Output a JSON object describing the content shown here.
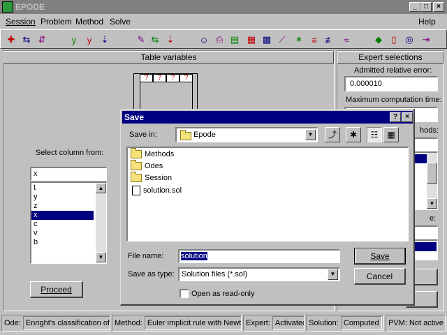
{
  "window": {
    "title": "EPODE",
    "icon": "app-icon"
  },
  "menu": {
    "session": "Session",
    "problem": "Problem",
    "method": "Method",
    "solve": "Solve",
    "help": "Help"
  },
  "toolbar": {
    "icons": [
      "new-problem-icon",
      "save-problem-icon",
      "open-problem-icon",
      "edit-function-icon",
      "edit-jacobian-icon",
      "load-icon",
      "pencil-icon",
      "method-select-icon",
      "method-load-icon",
      "user-icon",
      "printer-icon",
      "table-icon",
      "grid-icon",
      "matrix-icon",
      "chart-icon",
      "phase-plot-icon",
      "range-plot-icon",
      "scale-plot-icon",
      "wave-plot-icon",
      "expert-icon",
      "book-icon",
      "help-circle-icon",
      "exit-icon"
    ]
  },
  "left_panel": {
    "header": "Table variables",
    "table_cells": [
      "?",
      "?",
      "?",
      "?"
    ],
    "select_label": "Select column from:",
    "column_value": "x",
    "columns": [
      "t",
      "y",
      "z",
      "x",
      "c",
      "v",
      "b"
    ],
    "selected_column": "x",
    "proceed": "Proceed"
  },
  "right_panel": {
    "header": "Expert selections",
    "rel_error_label": "Admitted relative error:",
    "rel_error_value": "0.000010",
    "max_time_label": "Maximum computation time:",
    "methods_frag": "hods:",
    "e_frag": "e:"
  },
  "dialog": {
    "title": "Save",
    "save_in_label": "Save in:",
    "save_in_value": "Epode",
    "files": [
      {
        "name": "Methods",
        "type": "folder"
      },
      {
        "name": "Odes",
        "type": "folder"
      },
      {
        "name": "Session",
        "type": "folder"
      },
      {
        "name": "solution.sol",
        "type": "file"
      }
    ],
    "file_name_label": "File name:",
    "file_name_value": "solution",
    "save_as_label": "Save as type:",
    "save_as_value": "Solution files (*.sol)",
    "readonly_label": "Open as read-only",
    "save_button": "Save",
    "cancel_button": "Cancel",
    "help_button": "?",
    "close_button": "×"
  },
  "status": {
    "ode_label": "Ode:",
    "ode_value": "Enright's classification of st",
    "method_label": "Method:",
    "method_value": "Euler implicit rule with Newton",
    "expert_label": "Expert:",
    "expert_value": "Activated",
    "solution_label": "Solution:",
    "solution_value": "Computed",
    "pvm_label": "PVM:",
    "pvm_value": "Not active"
  }
}
